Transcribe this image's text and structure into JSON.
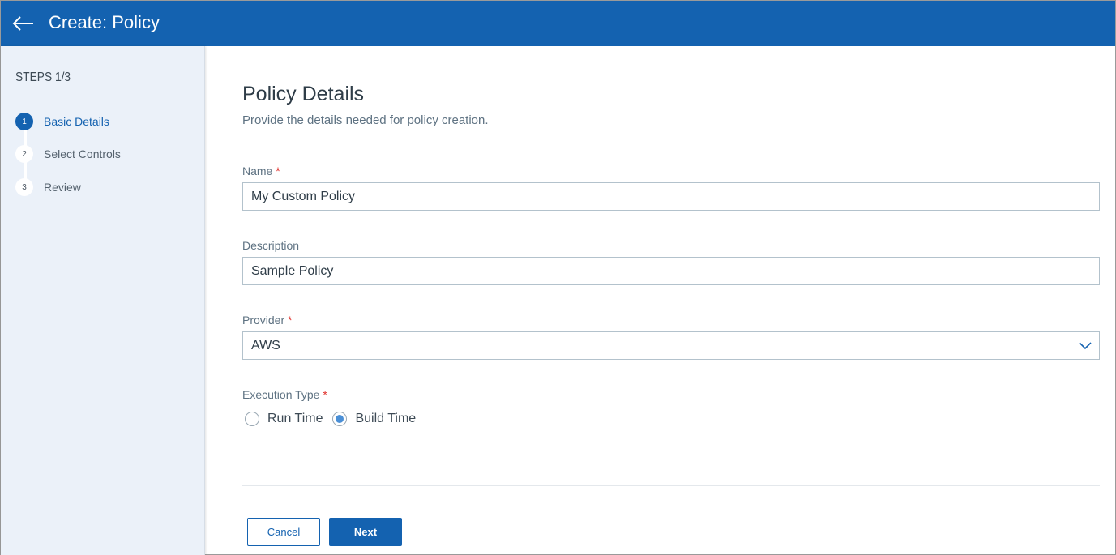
{
  "header": {
    "title": "Create: Policy",
    "back_icon": "arrow-left-icon"
  },
  "sidebar": {
    "steps_title": "STEPS 1/3",
    "steps": [
      {
        "number": "1",
        "label": "Basic Details",
        "active": true
      },
      {
        "number": "2",
        "label": "Select Controls",
        "active": false
      },
      {
        "number": "3",
        "label": "Review",
        "active": false
      }
    ]
  },
  "main": {
    "heading": "Policy Details",
    "subheading": "Provide the details needed for policy creation.",
    "fields": {
      "name": {
        "label": "Name",
        "required": "*",
        "value": "My Custom Policy"
      },
      "description": {
        "label": "Description",
        "value": "Sample Policy"
      },
      "provider": {
        "label": "Provider",
        "required": "*",
        "value": "AWS",
        "icon": "chevron-down-icon"
      },
      "execution_type": {
        "label": "Execution Type",
        "required": "*",
        "options": [
          {
            "label": "Run Time",
            "selected": false
          },
          {
            "label": "Build Time",
            "selected": true
          }
        ]
      }
    },
    "buttons": {
      "cancel": "Cancel",
      "next": "Next"
    }
  },
  "colors": {
    "brand": "#1462b0",
    "required": "#e0302b",
    "radio_selected": "#4a8fd6"
  }
}
